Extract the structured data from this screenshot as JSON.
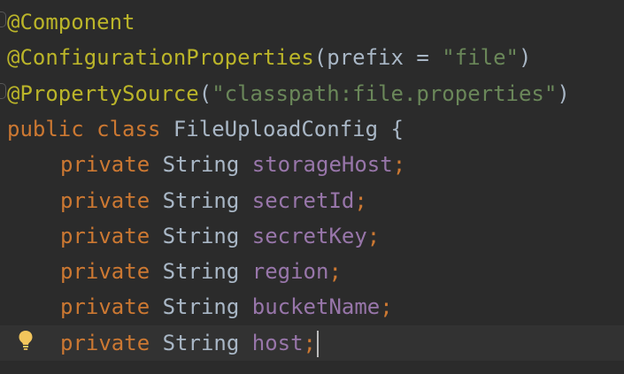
{
  "editor": {
    "language": "java",
    "lines": [
      {
        "tokens": [
          {
            "text": "@Component",
            "kind": "annotation"
          }
        ]
      },
      {
        "tokens": [
          {
            "text": "@ConfigurationProperties",
            "kind": "annotation"
          },
          {
            "text": "(",
            "kind": "punct"
          },
          {
            "text": "prefix",
            "kind": "ident"
          },
          {
            "text": " = ",
            "kind": "punct"
          },
          {
            "text": "\"file\"",
            "kind": "string"
          },
          {
            "text": ")",
            "kind": "punct"
          }
        ]
      },
      {
        "tokens": [
          {
            "text": "@PropertySource",
            "kind": "annotation"
          },
          {
            "text": "(",
            "kind": "punct"
          },
          {
            "text": "\"classpath:file.properties\"",
            "kind": "string"
          },
          {
            "text": ")",
            "kind": "punct"
          }
        ]
      },
      {
        "tokens": [
          {
            "text": "public",
            "kind": "keyword"
          },
          {
            "text": " ",
            "kind": "punct"
          },
          {
            "text": "class",
            "kind": "keyword"
          },
          {
            "text": " FileUploadConfig {",
            "kind": "ident"
          }
        ]
      },
      {
        "indent": true,
        "tokens": [
          {
            "text": "private",
            "kind": "keyword"
          },
          {
            "text": " String ",
            "kind": "type"
          },
          {
            "text": "storageHost",
            "kind": "field"
          },
          {
            "text": ";",
            "kind": "semicolon"
          }
        ]
      },
      {
        "indent": true,
        "tokens": [
          {
            "text": "private",
            "kind": "keyword"
          },
          {
            "text": " String ",
            "kind": "type"
          },
          {
            "text": "secretId",
            "kind": "field"
          },
          {
            "text": ";",
            "kind": "semicolon"
          }
        ]
      },
      {
        "indent": true,
        "tokens": [
          {
            "text": "private",
            "kind": "keyword"
          },
          {
            "text": " String ",
            "kind": "type"
          },
          {
            "text": "secretKey",
            "kind": "field"
          },
          {
            "text": ";",
            "kind": "semicolon"
          }
        ]
      },
      {
        "indent": true,
        "tokens": [
          {
            "text": "private",
            "kind": "keyword"
          },
          {
            "text": " String ",
            "kind": "type"
          },
          {
            "text": "region",
            "kind": "field"
          },
          {
            "text": ";",
            "kind": "semicolon"
          }
        ]
      },
      {
        "indent": true,
        "tokens": [
          {
            "text": "private",
            "kind": "keyword"
          },
          {
            "text": " String ",
            "kind": "type"
          },
          {
            "text": "bucketName",
            "kind": "field"
          },
          {
            "text": ";",
            "kind": "semicolon"
          }
        ]
      },
      {
        "indent": true,
        "current": true,
        "tokens": [
          {
            "text": "private",
            "kind": "keyword"
          },
          {
            "text": " String ",
            "kind": "type"
          },
          {
            "text": "host",
            "kind": "field"
          },
          {
            "text": ";",
            "kind": "semicolon"
          }
        ]
      }
    ],
    "gutter_icons": [
      {
        "line": 0,
        "icon": "fold-marker-icon"
      },
      {
        "line": 2,
        "icon": "fold-marker-icon"
      },
      {
        "line": 9,
        "icon": "lightbulb-icon"
      }
    ],
    "colors": {
      "background": "#2b2b2b",
      "current_line": "#323232",
      "annotation": "#bbb529",
      "keyword": "#cc7832",
      "identifier": "#a9b7c6",
      "field": "#9876aa",
      "string": "#6a8759",
      "bulb": "#f2c55c"
    }
  }
}
